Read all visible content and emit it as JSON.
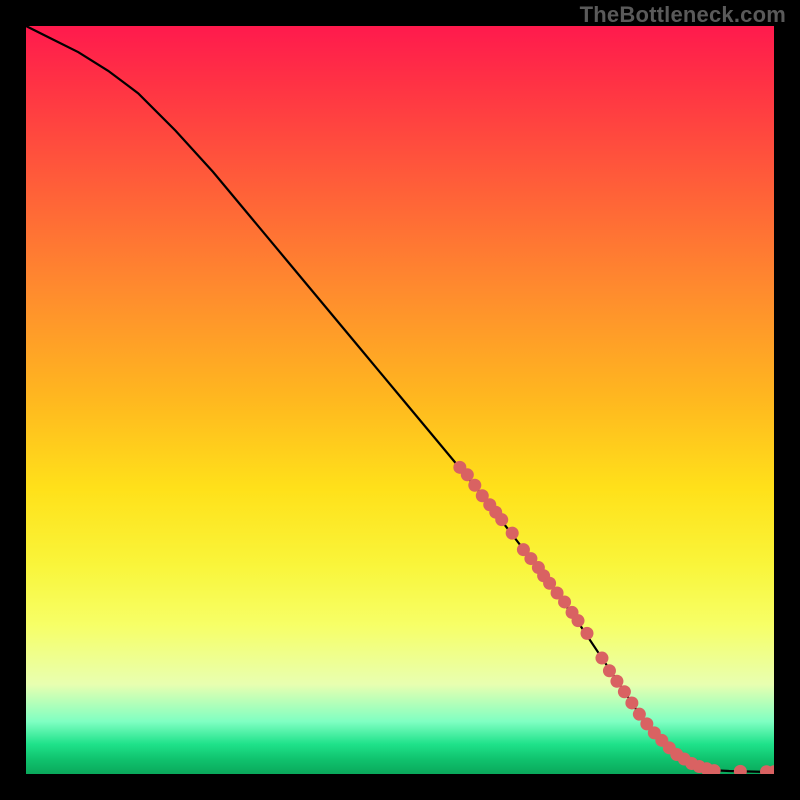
{
  "watermark": "TheBottleneck.com",
  "colors": {
    "line": "#000000",
    "marker": "#d96262",
    "background_frame": "#000000"
  },
  "chart_data": {
    "type": "line",
    "title": "",
    "xlabel": "",
    "ylabel": "",
    "xlim": [
      0,
      100
    ],
    "ylim": [
      0,
      100
    ],
    "grid": false,
    "legend": false,
    "annotations": [
      "TheBottleneck.com"
    ],
    "series": [
      {
        "name": "curve",
        "x": [
          0,
          3,
          7,
          11,
          15,
          20,
          25,
          30,
          35,
          40,
          45,
          50,
          55,
          60,
          65,
          70,
          74,
          77,
          80,
          82,
          84,
          86,
          88,
          90,
          92,
          94,
          96,
          98,
          100
        ],
        "y": [
          100,
          98.5,
          96.5,
          94,
          91,
          86,
          80.5,
          74.5,
          68.5,
          62.5,
          56.5,
          50.5,
          44.5,
          38.5,
          32,
          25.5,
          20,
          15.5,
          11,
          8,
          5.5,
          3.5,
          2,
          1,
          0.5,
          0.4,
          0.35,
          0.3,
          0.3
        ]
      }
    ],
    "markers": [
      {
        "x": 58,
        "y": 41
      },
      {
        "x": 59,
        "y": 40
      },
      {
        "x": 60,
        "y": 38.6
      },
      {
        "x": 61,
        "y": 37.2
      },
      {
        "x": 62,
        "y": 36
      },
      {
        "x": 62.8,
        "y": 35
      },
      {
        "x": 63.6,
        "y": 34
      },
      {
        "x": 65,
        "y": 32.2
      },
      {
        "x": 66.5,
        "y": 30
      },
      {
        "x": 67.5,
        "y": 28.8
      },
      {
        "x": 68.5,
        "y": 27.6
      },
      {
        "x": 69.2,
        "y": 26.5
      },
      {
        "x": 70,
        "y": 25.5
      },
      {
        "x": 71,
        "y": 24.2
      },
      {
        "x": 72,
        "y": 23
      },
      {
        "x": 73,
        "y": 21.6
      },
      {
        "x": 73.8,
        "y": 20.5
      },
      {
        "x": 75,
        "y": 18.8
      },
      {
        "x": 77,
        "y": 15.5
      },
      {
        "x": 78,
        "y": 13.8
      },
      {
        "x": 79,
        "y": 12.4
      },
      {
        "x": 80,
        "y": 11
      },
      {
        "x": 81,
        "y": 9.5
      },
      {
        "x": 82,
        "y": 8
      },
      {
        "x": 83,
        "y": 6.7
      },
      {
        "x": 84,
        "y": 5.5
      },
      {
        "x": 85,
        "y": 4.5
      },
      {
        "x": 86,
        "y": 3.5
      },
      {
        "x": 87,
        "y": 2.6
      },
      {
        "x": 88,
        "y": 2
      },
      {
        "x": 89,
        "y": 1.4
      },
      {
        "x": 90,
        "y": 1
      },
      {
        "x": 91,
        "y": 0.7
      },
      {
        "x": 92,
        "y": 0.45
      },
      {
        "x": 95.5,
        "y": 0.35
      },
      {
        "x": 99,
        "y": 0.3
      },
      {
        "x": 100,
        "y": 0.3
      }
    ]
  }
}
